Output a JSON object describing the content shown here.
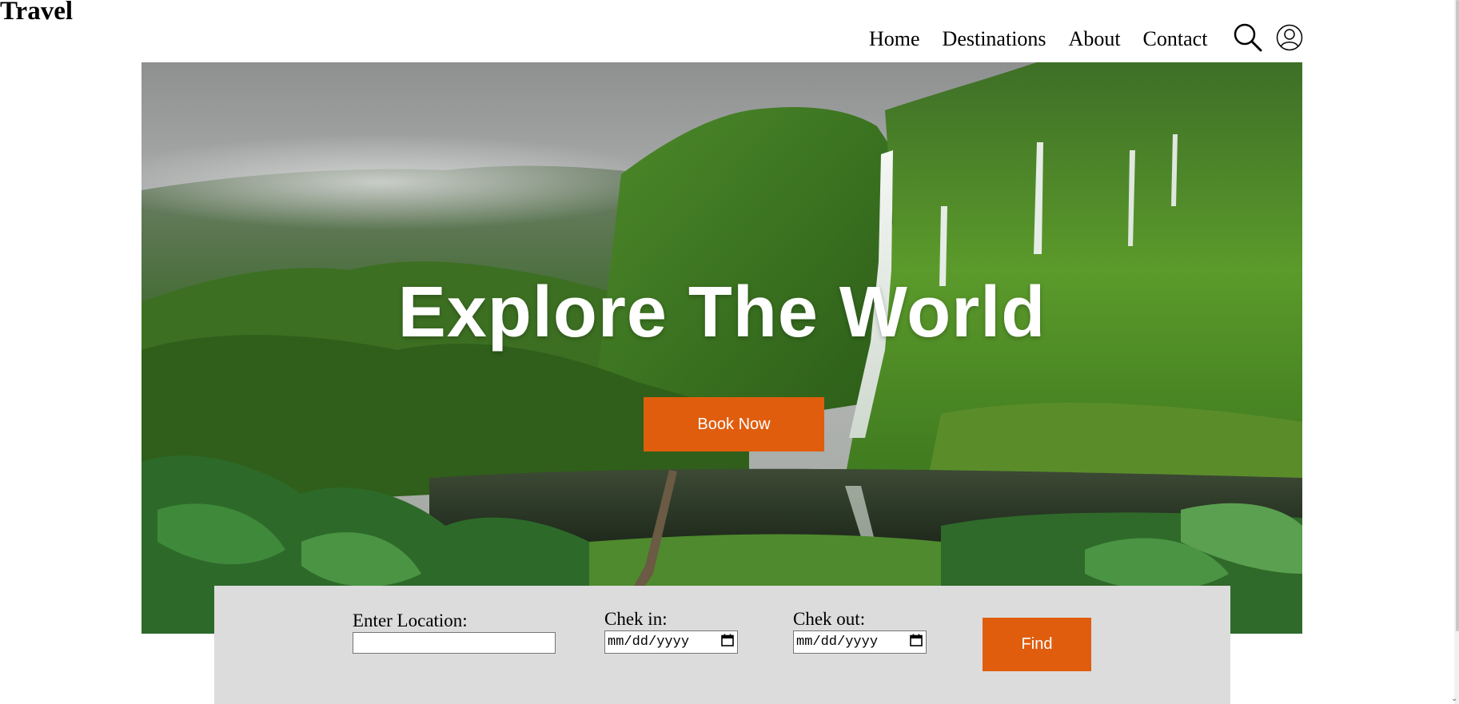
{
  "logo": "Travel",
  "nav": {
    "items": [
      "Home",
      "Destinations",
      "About",
      "Contact"
    ],
    "search_icon": "search-icon",
    "account_icon": "user-account-icon"
  },
  "hero": {
    "title": "Explore The World",
    "cta_label": "Book Now",
    "background": "tropical waterfall valley with lake"
  },
  "search": {
    "location_label": "Enter Location:",
    "location_value": "",
    "checkin_label": "Chek in:",
    "checkin_placeholder": "mm/dd/yyyy",
    "checkout_label": "Chek out:",
    "checkout_placeholder": "mm/dd/yyyy",
    "calendar_icon": "calendar-icon",
    "find_label": "Find"
  },
  "colors": {
    "accent": "#e05d0e",
    "panel": "#dcdcdc"
  }
}
